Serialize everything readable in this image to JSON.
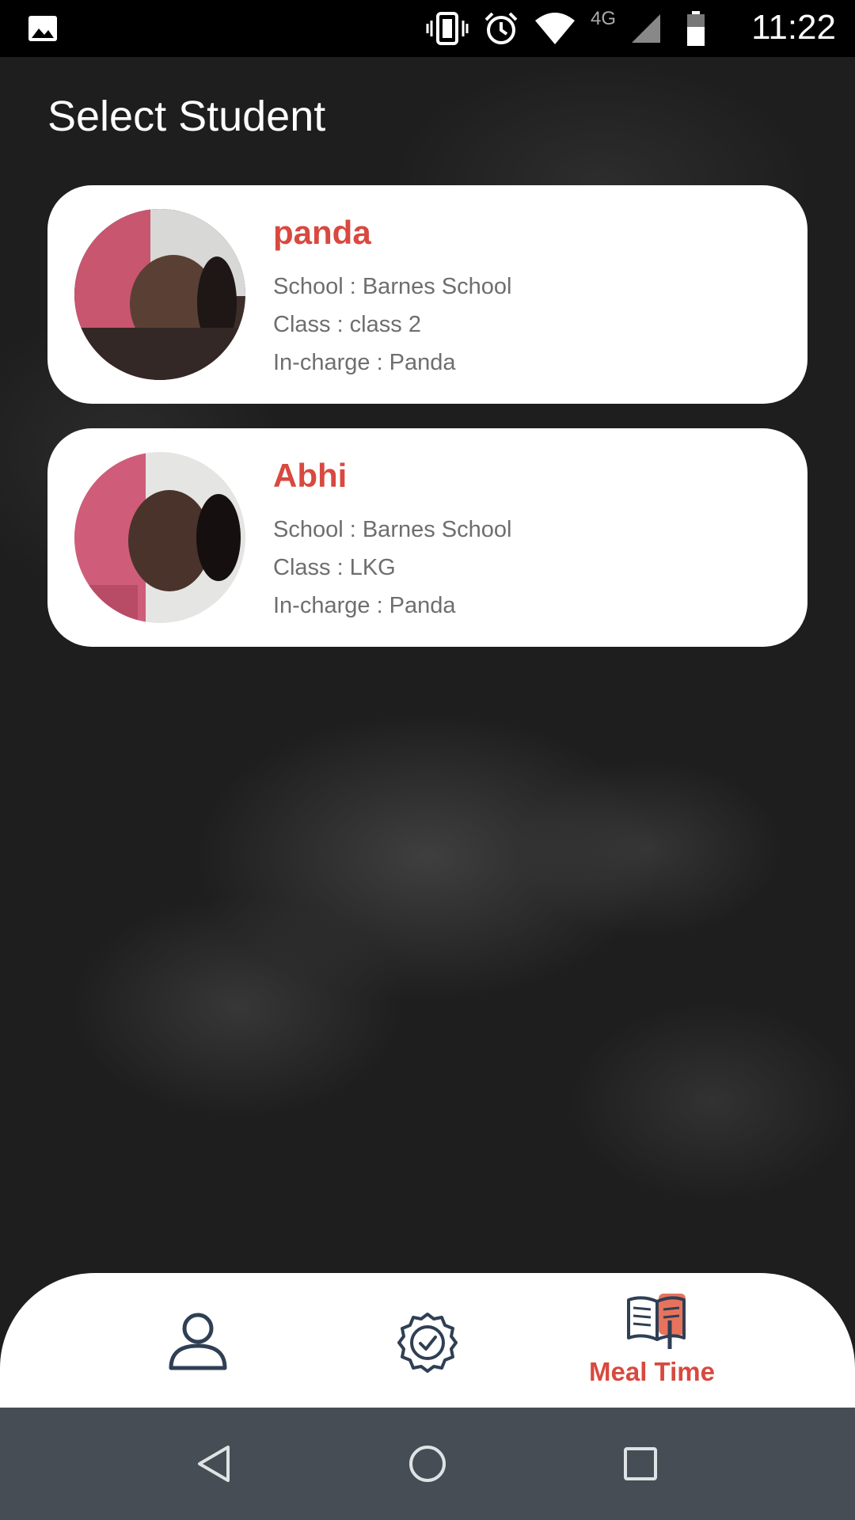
{
  "status_bar": {
    "time": "11:22",
    "network": "4G",
    "icons": [
      "gallery-icon",
      "vibrate-icon",
      "alarm-icon",
      "wifi-icon",
      "signal-icon",
      "battery-icon"
    ]
  },
  "page": {
    "title": "Select Student"
  },
  "students": [
    {
      "name": "panda",
      "school": "School : Barnes School",
      "class": "Class : class 2",
      "incharge": "In-charge : Panda"
    },
    {
      "name": "Abhi",
      "school": "School : Barnes School",
      "class": "Class : LKG",
      "incharge": "In-charge : Panda"
    }
  ],
  "bottom_nav": {
    "items": [
      {
        "icon": "profile-icon",
        "label": ""
      },
      {
        "icon": "badge-check-icon",
        "label": ""
      },
      {
        "icon": "book-icon",
        "label": "Meal Time",
        "active": true
      }
    ]
  },
  "system_nav": [
    "back-icon",
    "home-icon",
    "recents-icon"
  ],
  "colors": {
    "accent": "#d8493f",
    "nav_icon": "#2f3f54",
    "system_nav_bg": "#474d54"
  }
}
